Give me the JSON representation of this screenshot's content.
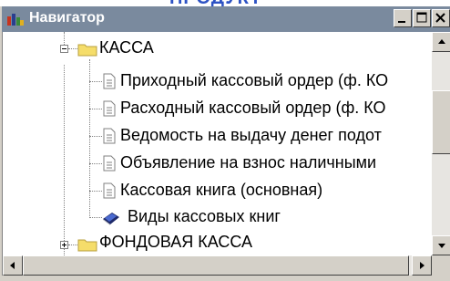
{
  "window": {
    "title": "Навигатор"
  },
  "tree": {
    "folder_kassa": "КАССА",
    "items": [
      "Приходный кассовый ордер (ф. КО",
      "Расходный кассовый ордер (ф. КО",
      "Ведомость на выдачу денег подот",
      "Объявление на взнос наличными",
      "Кассовая книга (основная)"
    ],
    "kinds_label": "Виды кассовых книг",
    "folder_fond": "ФОНДОВАЯ КАССА"
  },
  "colors": {
    "titlebar": "#7a8a9e",
    "folder": "#f5dd6a",
    "window_face": "#d4d0c8"
  },
  "icons": {
    "app": "app-icon",
    "minimize": "minimize-icon",
    "maximize": "maximize-icon",
    "close": "close-icon",
    "folder": "folder-icon",
    "document": "document-icon",
    "book": "book-icon"
  }
}
